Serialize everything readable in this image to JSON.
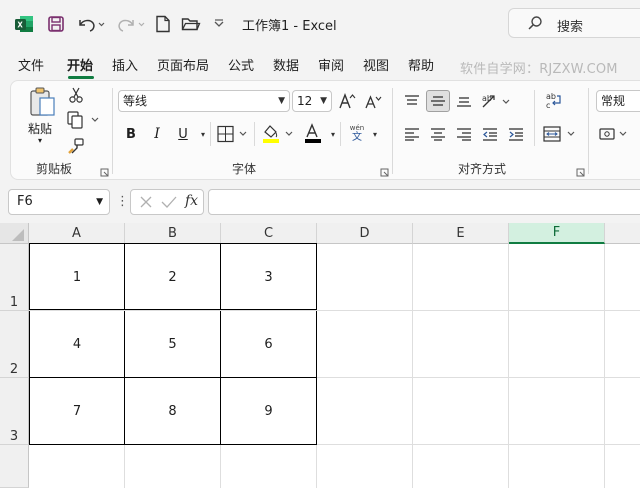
{
  "window": {
    "title": "工作簿1  -  Excel"
  },
  "search": {
    "placeholder": "搜索"
  },
  "tabs": [
    "文件",
    "开始",
    "插入",
    "页面布局",
    "公式",
    "数据",
    "审阅",
    "视图",
    "帮助"
  ],
  "active_tab": "开始",
  "watermark": "软件自学网：RJZXW.COM",
  "ribbon": {
    "clipboard": {
      "paste_label": "粘贴",
      "group_label": "剪贴板"
    },
    "font": {
      "font_name": "等线",
      "font_size": "12",
      "bold": "B",
      "italic": "I",
      "underline": "U",
      "font_color_glyph": "A",
      "phonetic_top": "wén",
      "phonetic_bottom": "文",
      "group_label": "字体"
    },
    "alignment": {
      "group_label": "对齐方式"
    },
    "number": {
      "format": "常规"
    }
  },
  "formula_bar": {
    "name_box": "F6",
    "fx_label": "fx",
    "formula_value": ""
  },
  "sheet": {
    "columns": [
      "A",
      "B",
      "C",
      "D",
      "E",
      "F"
    ],
    "selected_column": "F",
    "rows": [
      "1",
      "2",
      "3"
    ],
    "cells": [
      [
        "1",
        "2",
        "3"
      ],
      [
        "4",
        "5",
        "6"
      ],
      [
        "7",
        "8",
        "9"
      ]
    ]
  },
  "colors": {
    "accent": "#107c41",
    "excel_green": "#1d6f42",
    "font_color_bar": "#000000",
    "highlight_bar": "#ffff00"
  }
}
